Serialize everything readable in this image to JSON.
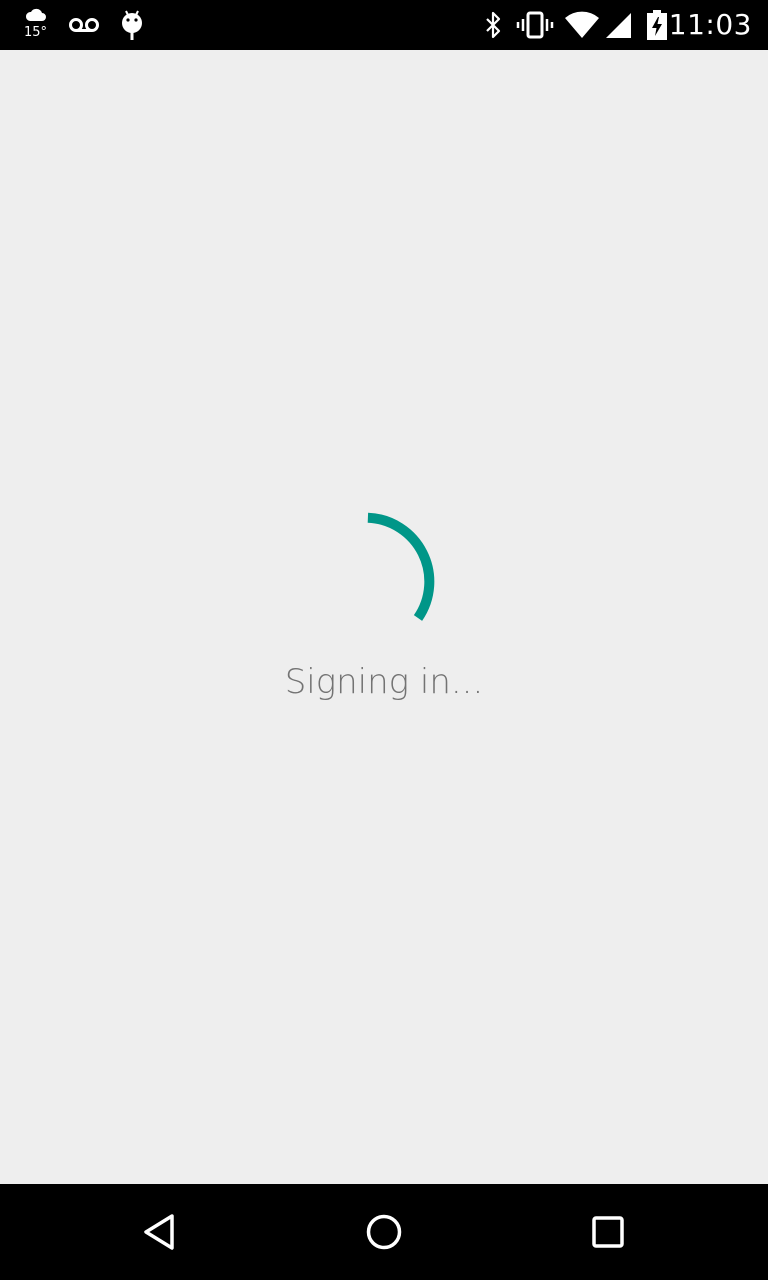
{
  "status_bar": {
    "weather_temp": "15°",
    "time": "11:03",
    "icons_left": [
      "weather-cloud-icon",
      "voicemail-icon",
      "android-debug-icon"
    ],
    "icons_right": [
      "bluetooth-icon",
      "vibrate-icon",
      "wifi-icon",
      "cell-signal-icon",
      "battery-charging-icon"
    ]
  },
  "main": {
    "status_text": "Signing in...",
    "spinner_color": "#009688"
  },
  "nav_bar": {
    "buttons": [
      "back-icon",
      "home-icon",
      "recents-icon"
    ]
  },
  "colors": {
    "background": "#eeeeee",
    "bars": "#000000",
    "text": "#737373",
    "accent": "#009688"
  }
}
